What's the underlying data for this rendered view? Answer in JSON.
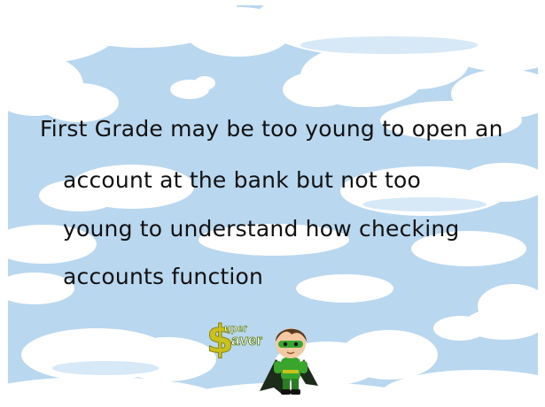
{
  "slide": {
    "body_lines": [
      "First Grade may be too young to open an",
      "account at the bank but not too",
      "young to understand how checking",
      "accounts function"
    ],
    "logo": {
      "symbol": "$",
      "word_top": "uper",
      "word_bottom": "aver"
    }
  },
  "colors": {
    "sky": "#b9d7ef",
    "cloud": "#ffffff",
    "text": "#111111",
    "logo_gold": "#c9c21e",
    "hero_green": "#3aa52c"
  },
  "icons": {
    "background": "cloud-sky-background",
    "mascot": "superhero-kid-icon"
  }
}
